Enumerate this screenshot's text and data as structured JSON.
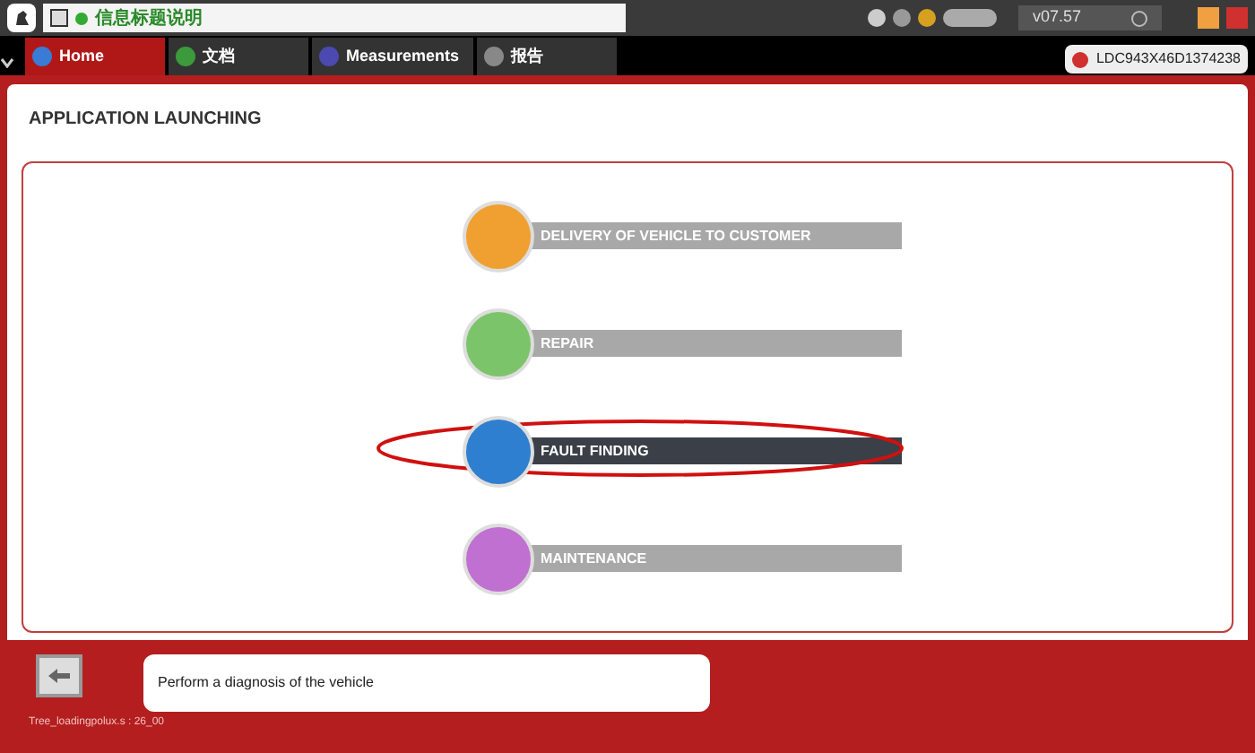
{
  "window": {
    "title": "信息标题说明",
    "version": "v07.57"
  },
  "tabs": [
    {
      "label": "Home",
      "selected": true
    },
    {
      "label": "文档",
      "selected": false
    },
    {
      "label": "Measurements",
      "selected": false
    },
    {
      "label": "报告",
      "selected": false
    }
  ],
  "vin": "LDC943X46D1374238",
  "page_title": "APPLICATION LAUNCHING",
  "menu": [
    {
      "label": "DELIVERY OF VEHICLE TO CUSTOMER",
      "selected": false,
      "color": "#f0a030"
    },
    {
      "label": "REPAIR",
      "selected": false,
      "color": "#7cc46a"
    },
    {
      "label": "FAULT FINDING",
      "selected": true,
      "color": "#2f7fd0"
    },
    {
      "label": "MAINTENANCE",
      "selected": false,
      "color": "#c070d0"
    }
  ],
  "description": "Perform a diagnosis of the vehicle",
  "status": "Tree_loadingpolux.s : 26_00"
}
